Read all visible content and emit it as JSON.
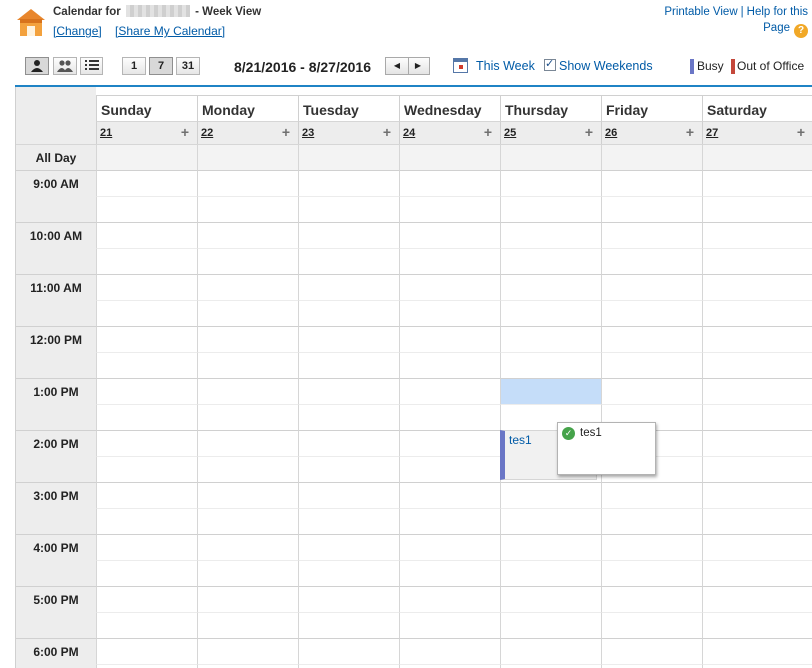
{
  "header": {
    "title_prefix": "Calendar for",
    "title_suffix": "- Week View",
    "change_link": "[Change]",
    "share_link": "[Share My Calendar]",
    "printable_view": "Printable View",
    "separator": "|",
    "help_line1": "Help for this",
    "help_line2": "Page"
  },
  "toolbar": {
    "view_buttons": [
      "single-user-icon",
      "multi-user-icon",
      "list-icon"
    ],
    "day_button": "1",
    "week_button": "7",
    "month_button": "31",
    "date_range": "8/21/2016 - 8/27/2016",
    "prev_label": "◀",
    "next_label": "▶",
    "this_week": "This Week",
    "show_weekends": "Show Weekends",
    "show_weekends_checked": true,
    "legend_busy": "Busy",
    "legend_busy_color": "#6a76c6",
    "legend_ooo": "Out of Office",
    "legend_ooo_color": "#c4473a"
  },
  "days": [
    {
      "name": "Sunday",
      "num": "21"
    },
    {
      "name": "Monday",
      "num": "22"
    },
    {
      "name": "Tuesday",
      "num": "23"
    },
    {
      "name": "Wednesday",
      "num": "24"
    },
    {
      "name": "Thursday",
      "num": "25"
    },
    {
      "name": "Friday",
      "num": "26"
    },
    {
      "name": "Saturday",
      "num": "27"
    }
  ],
  "add_symbol": "+",
  "all_day_label": "All Day",
  "hours": [
    "9:00 AM",
    "10:00 AM",
    "11:00 AM",
    "12:00 PM",
    "1:00 PM",
    "2:00 PM",
    "3:00 PM",
    "4:00 PM",
    "5:00 PM",
    "6:00 PM"
  ],
  "selected_slot": {
    "day": "Thursday",
    "time": "1:00 PM"
  },
  "event": {
    "title": "tes1",
    "day": "Thursday",
    "time": "2:00 PM"
  },
  "popup": {
    "title": "tes1",
    "icon": "check-icon"
  }
}
